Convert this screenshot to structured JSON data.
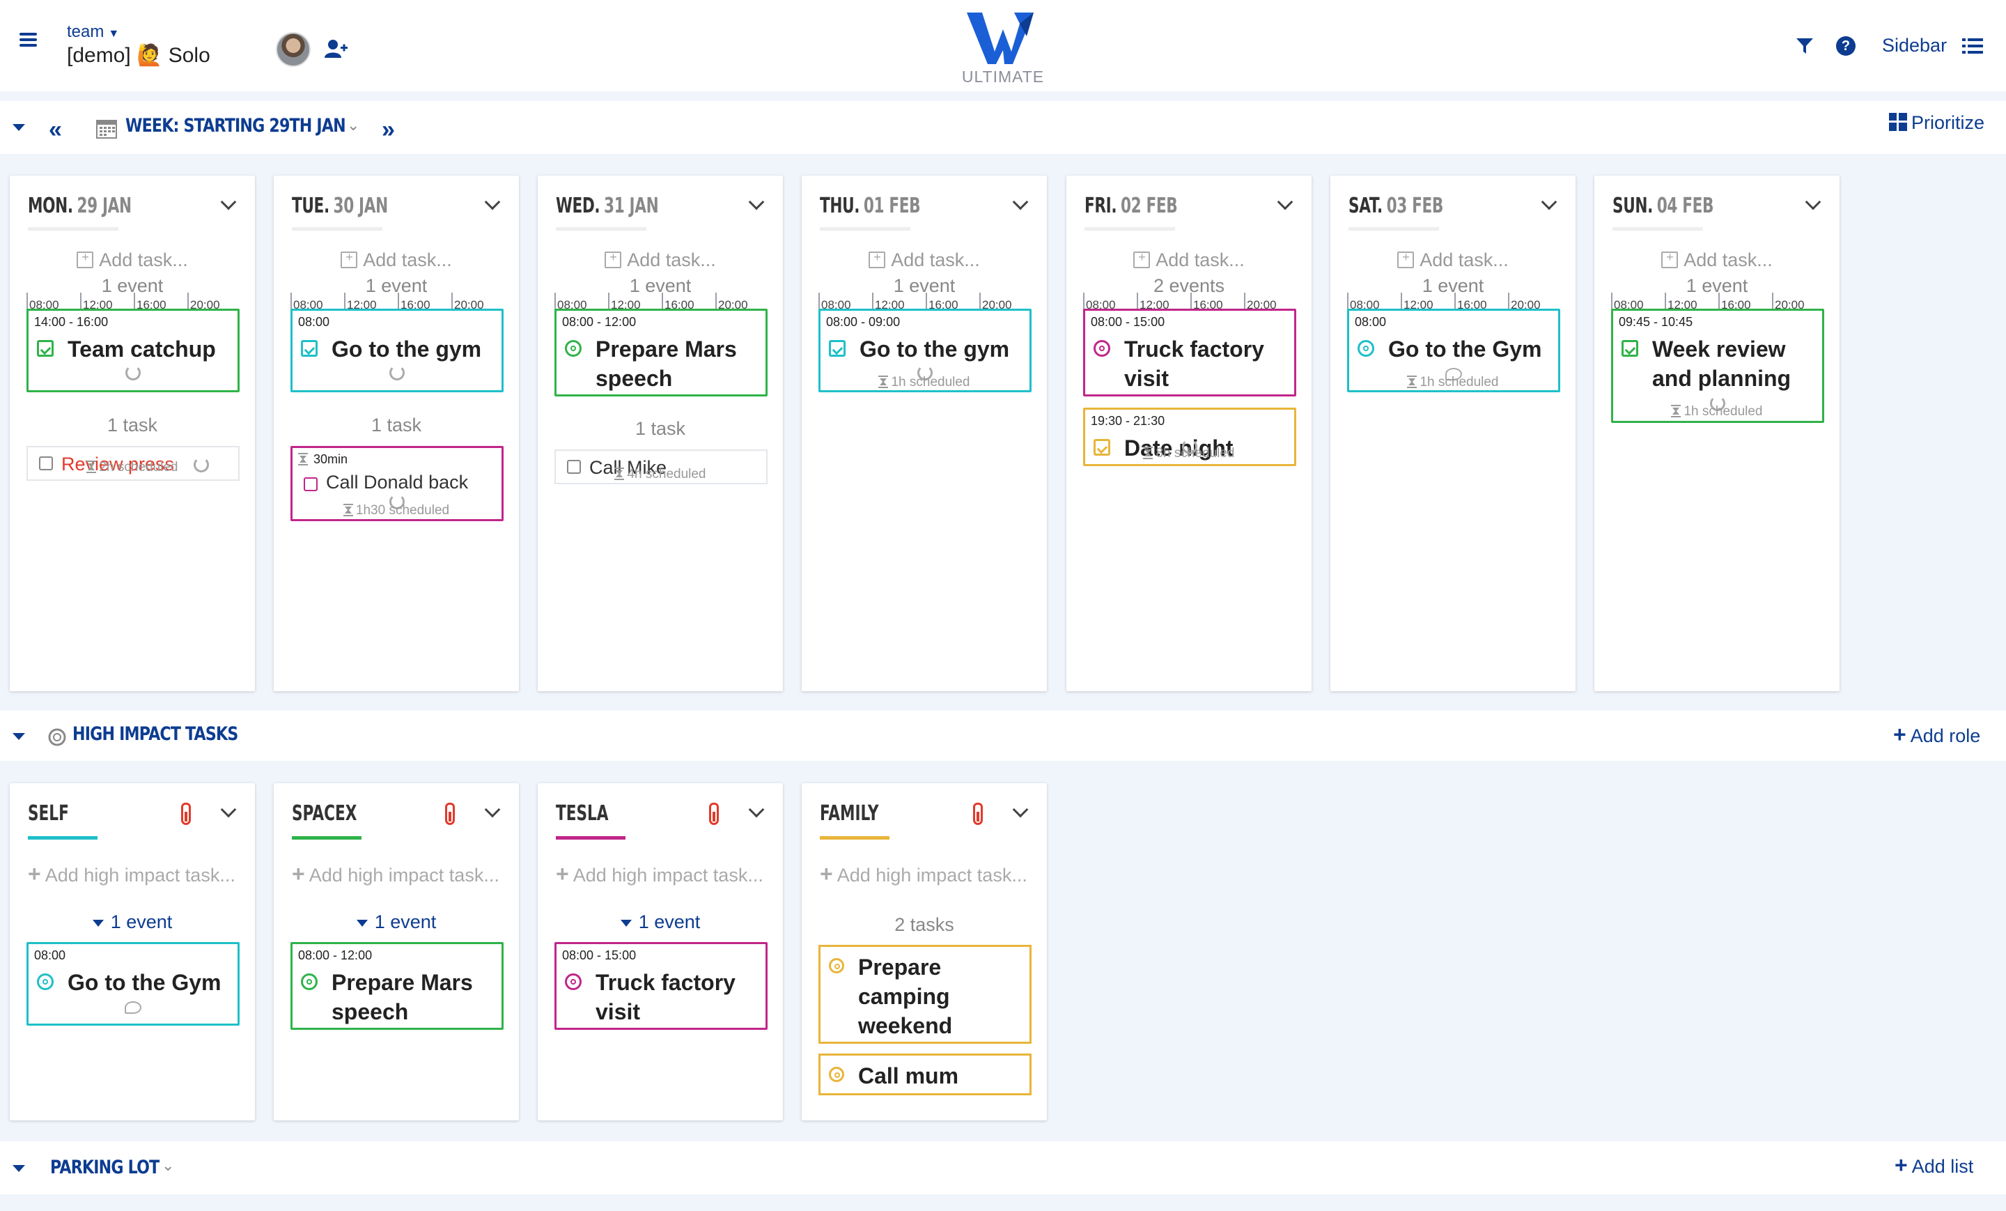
{
  "header": {
    "team_label": "team",
    "team_name": "[demo] 🙋 Solo",
    "logo_text": "ULTIMATE",
    "sidebar_label": "Sidebar"
  },
  "week_bar": {
    "title": "WEEK: STARTING 29TH JAN",
    "prioritize_label": "Prioritize"
  },
  "timeline_hours": [
    "08:00",
    "12:00",
    "16:00",
    "20:00"
  ],
  "days": [
    {
      "name": "MON.",
      "date": "29 JAN",
      "add_task": "Add task...",
      "events_count": "1 event",
      "events": [
        {
          "time": "14:00 - 16:00",
          "title": "Team catchup",
          "color": "#2fb34a",
          "icon": "calendar-check-icon",
          "sub": "repeat-icon"
        }
      ],
      "tasks_count": "1 task",
      "tasks": [
        {
          "label": "Review press",
          "color": "#e23a2a"
        }
      ],
      "scheduled": "2h scheduled"
    },
    {
      "name": "TUE.",
      "date": "30 JAN",
      "add_task": "Add task...",
      "events_count": "1 event",
      "events": [
        {
          "time": "08:00",
          "title": "Go to the gym",
          "color": "#1ec0c8",
          "icon": "calendar-check-icon",
          "sub": "repeat-icon"
        }
      ],
      "tasks_count": "1 task",
      "tasks": [
        {
          "label": "Call Donald back",
          "duration": "30min",
          "color": "#c1268a"
        }
      ],
      "scheduled": "1h30 scheduled"
    },
    {
      "name": "WED.",
      "date": "31 JAN",
      "add_task": "Add task...",
      "events_count": "1 event",
      "events": [
        {
          "time": "08:00 - 12:00",
          "title": "Prepare Mars speech",
          "color": "#2fb34a",
          "icon": "target-icon",
          "sub": ""
        }
      ],
      "tasks_count": "1 task",
      "tasks": [
        {
          "label": "Call Mike",
          "color": "#333333"
        }
      ],
      "scheduled": "4h scheduled"
    },
    {
      "name": "THU.",
      "date": "01 FEB",
      "add_task": "Add task...",
      "events_count": "1 event",
      "events": [
        {
          "time": "08:00 - 09:00",
          "title": "Go to the gym",
          "color": "#1ec0c8",
          "icon": "calendar-check-icon",
          "sub": "repeat-icon"
        }
      ],
      "tasks_count": "",
      "tasks": [],
      "scheduled": "1h scheduled"
    },
    {
      "name": "FRI.",
      "date": "02 FEB",
      "add_task": "Add task...",
      "events_count": "2 events",
      "events": [
        {
          "time": "08:00 - 15:00",
          "title": "Truck factory visit",
          "color": "#c1268a",
          "icon": "target-icon",
          "sub": ""
        },
        {
          "time": "19:30 - 21:30",
          "title": "Date night",
          "color": "#e8b53a",
          "icon": "calendar-check-icon",
          "sub": "repeat-icon"
        }
      ],
      "tasks_count": "",
      "tasks": [],
      "scheduled": "8h scheduled"
    },
    {
      "name": "SAT.",
      "date": "03 FEB",
      "add_task": "Add task...",
      "events_count": "1 event",
      "events": [
        {
          "time": "08:00",
          "title": "Go to the Gym",
          "color": "#1ec0c8",
          "icon": "target-icon",
          "sub": "comment-icon"
        }
      ],
      "tasks_count": "",
      "tasks": [],
      "scheduled": "1h scheduled"
    },
    {
      "name": "SUN.",
      "date": "04 FEB",
      "add_task": "Add task...",
      "events_count": "1 event",
      "events": [
        {
          "time": "09:45 - 10:45",
          "title": "Week review and planning",
          "color": "#2fb34a",
          "icon": "calendar-check-icon",
          "sub": "repeat-icon"
        }
      ],
      "tasks_count": "",
      "tasks": [],
      "scheduled": "1h scheduled"
    }
  ],
  "high_impact": {
    "title": "HIGH IMPACT TASKS",
    "add_role_label": "Add role",
    "roles": [
      {
        "name": "SELF",
        "color": "#1ec0c8",
        "add_label": "Add high impact task...",
        "toggle": "1 event",
        "event": {
          "time": "08:00",
          "title": "Go to the Gym",
          "color": "#1ec0c8",
          "sub": "comment-icon"
        }
      },
      {
        "name": "SPACEX",
        "color": "#2fb34a",
        "add_label": "Add high impact task...",
        "toggle": "1 event",
        "event": {
          "time": "08:00 - 12:00",
          "title": "Prepare Mars speech",
          "color": "#2fb34a",
          "sub": ""
        }
      },
      {
        "name": "TESLA",
        "color": "#c1268a",
        "add_label": "Add high impact task...",
        "toggle": "1 event",
        "event": {
          "time": "08:00 - 15:00",
          "title": "Truck factory visit",
          "color": "#c1268a",
          "sub": ""
        }
      },
      {
        "name": "FAMILY",
        "color": "#e8b53a",
        "add_label": "Add high impact task...",
        "tasks_count": "2 tasks",
        "tasks": [
          "Prepare camping weekend",
          "Call mum"
        ]
      }
    ]
  },
  "parking_lot": {
    "title": "PARKING LOT",
    "add_list_label": "Add list"
  }
}
